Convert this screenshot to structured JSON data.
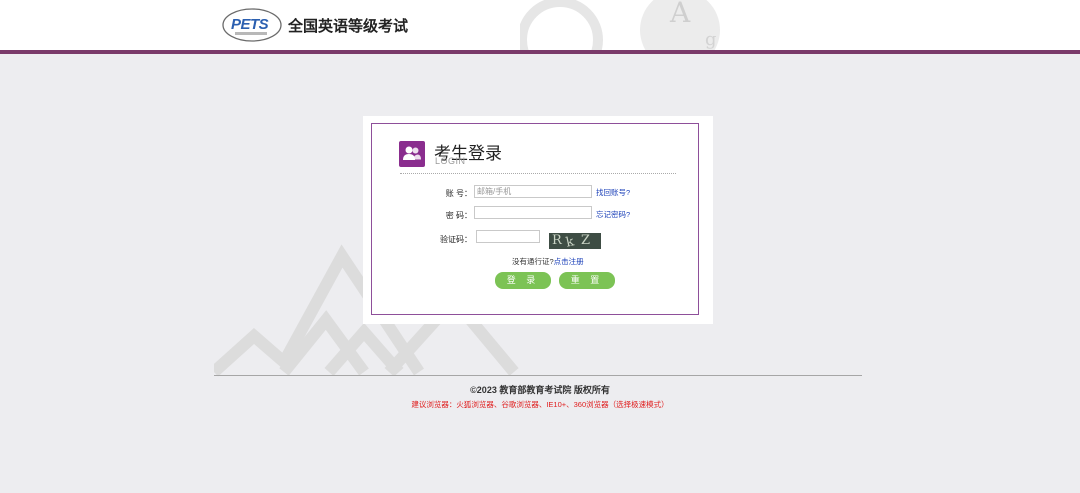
{
  "header": {
    "logo_text": "PETS",
    "site_title": "全国英语等级考试",
    "deco_letters": [
      "A",
      "g"
    ]
  },
  "login": {
    "icon": "users-icon",
    "title": "考生登录",
    "subtitle": "LOGIN",
    "account_label": "账  号：",
    "account_placeholder": "邮箱/手机",
    "account_value": "",
    "find_account_link": "找回账号?",
    "password_label": "密  码：",
    "password_value": "",
    "forgot_password_link": "忘记密码?",
    "captcha_label": "验证码：",
    "captcha_value": "",
    "captcha_chars": [
      "R",
      "k",
      "Z"
    ],
    "register_prompt": "没有通行证?",
    "register_link": "点击注册",
    "login_button": "登 录",
    "reset_button": "重 置"
  },
  "footer": {
    "copyright": "©2023   教育部教育考试院   版权所有",
    "browser_tip": "建议浏览器：火狐浏览器、谷歌浏览器、IE10+、360浏览器（选择极速模式）"
  },
  "colors": {
    "header_bar": "#7a3a6a",
    "card_border": "#8e4f9a",
    "icon_bg": "#8a2d8e",
    "button": "#7cc355",
    "link": "#1a3fb8",
    "tip": "#e02020"
  }
}
